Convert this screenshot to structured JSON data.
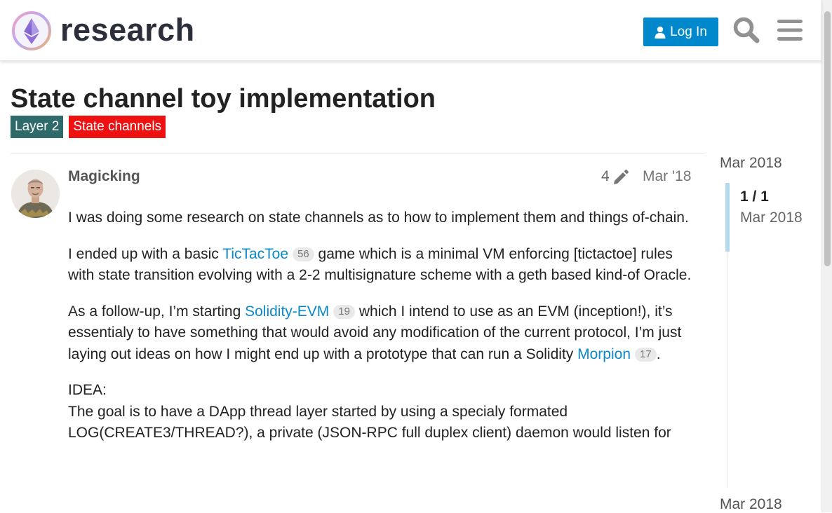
{
  "header": {
    "logo_text": "research",
    "login_label": "Log In"
  },
  "topic": {
    "title": "State channel toy implementation",
    "tags": [
      "Layer 2",
      "State channels"
    ]
  },
  "post": {
    "author": "Magicking",
    "edit_count": "4",
    "date": "Mar '18",
    "paragraphs": {
      "p1": "I was doing some research on state channels as to how to implement them and things of-chain.",
      "p2_before": "I ended up with a basic ",
      "p2_link": "TicTacToe",
      "p2_link_clicks": "56",
      "p2_after": " game which is a minimal VM enforcing [tictactoe] rules with state transition evolving with a 2-2 multisignature scheme with a geth based kind-of Oracle.",
      "p3_before": "As a follow-up, I’m starting ",
      "p3_link1": "Solidity-EVM",
      "p3_link1_clicks": "19",
      "p3_middle": " which I intend to use as an EVM (inception!), it’s essentialy to have something that would avoid any modification of the current protocol, I’m just laying out ideas on how I might end up with a prototype that can run a Solidity ",
      "p3_link2": "Morpion",
      "p3_link2_clicks": "17",
      "p3_after": ".",
      "p4_heading": "IDEA:",
      "p4_text": "The goal is to have a DApp thread layer started by using a specialy formated LOG(CREATE3/THREAD?), a private (JSON-RPC full duplex client) daemon would listen for"
    }
  },
  "timeline": {
    "start_date": "Mar 2018",
    "position": "1 / 1",
    "handle_date": "Mar 2018",
    "end_date": "Mar 2018"
  },
  "colors": {
    "accent": "#0088cc",
    "tag_layer2": "#2f6a6b",
    "tag_state_channels": "#ee1111",
    "link": "#0a88c9"
  },
  "icons": [
    "ethereum-logo-icon",
    "user-icon",
    "search-icon",
    "menu-icon",
    "pencil-icon"
  ]
}
